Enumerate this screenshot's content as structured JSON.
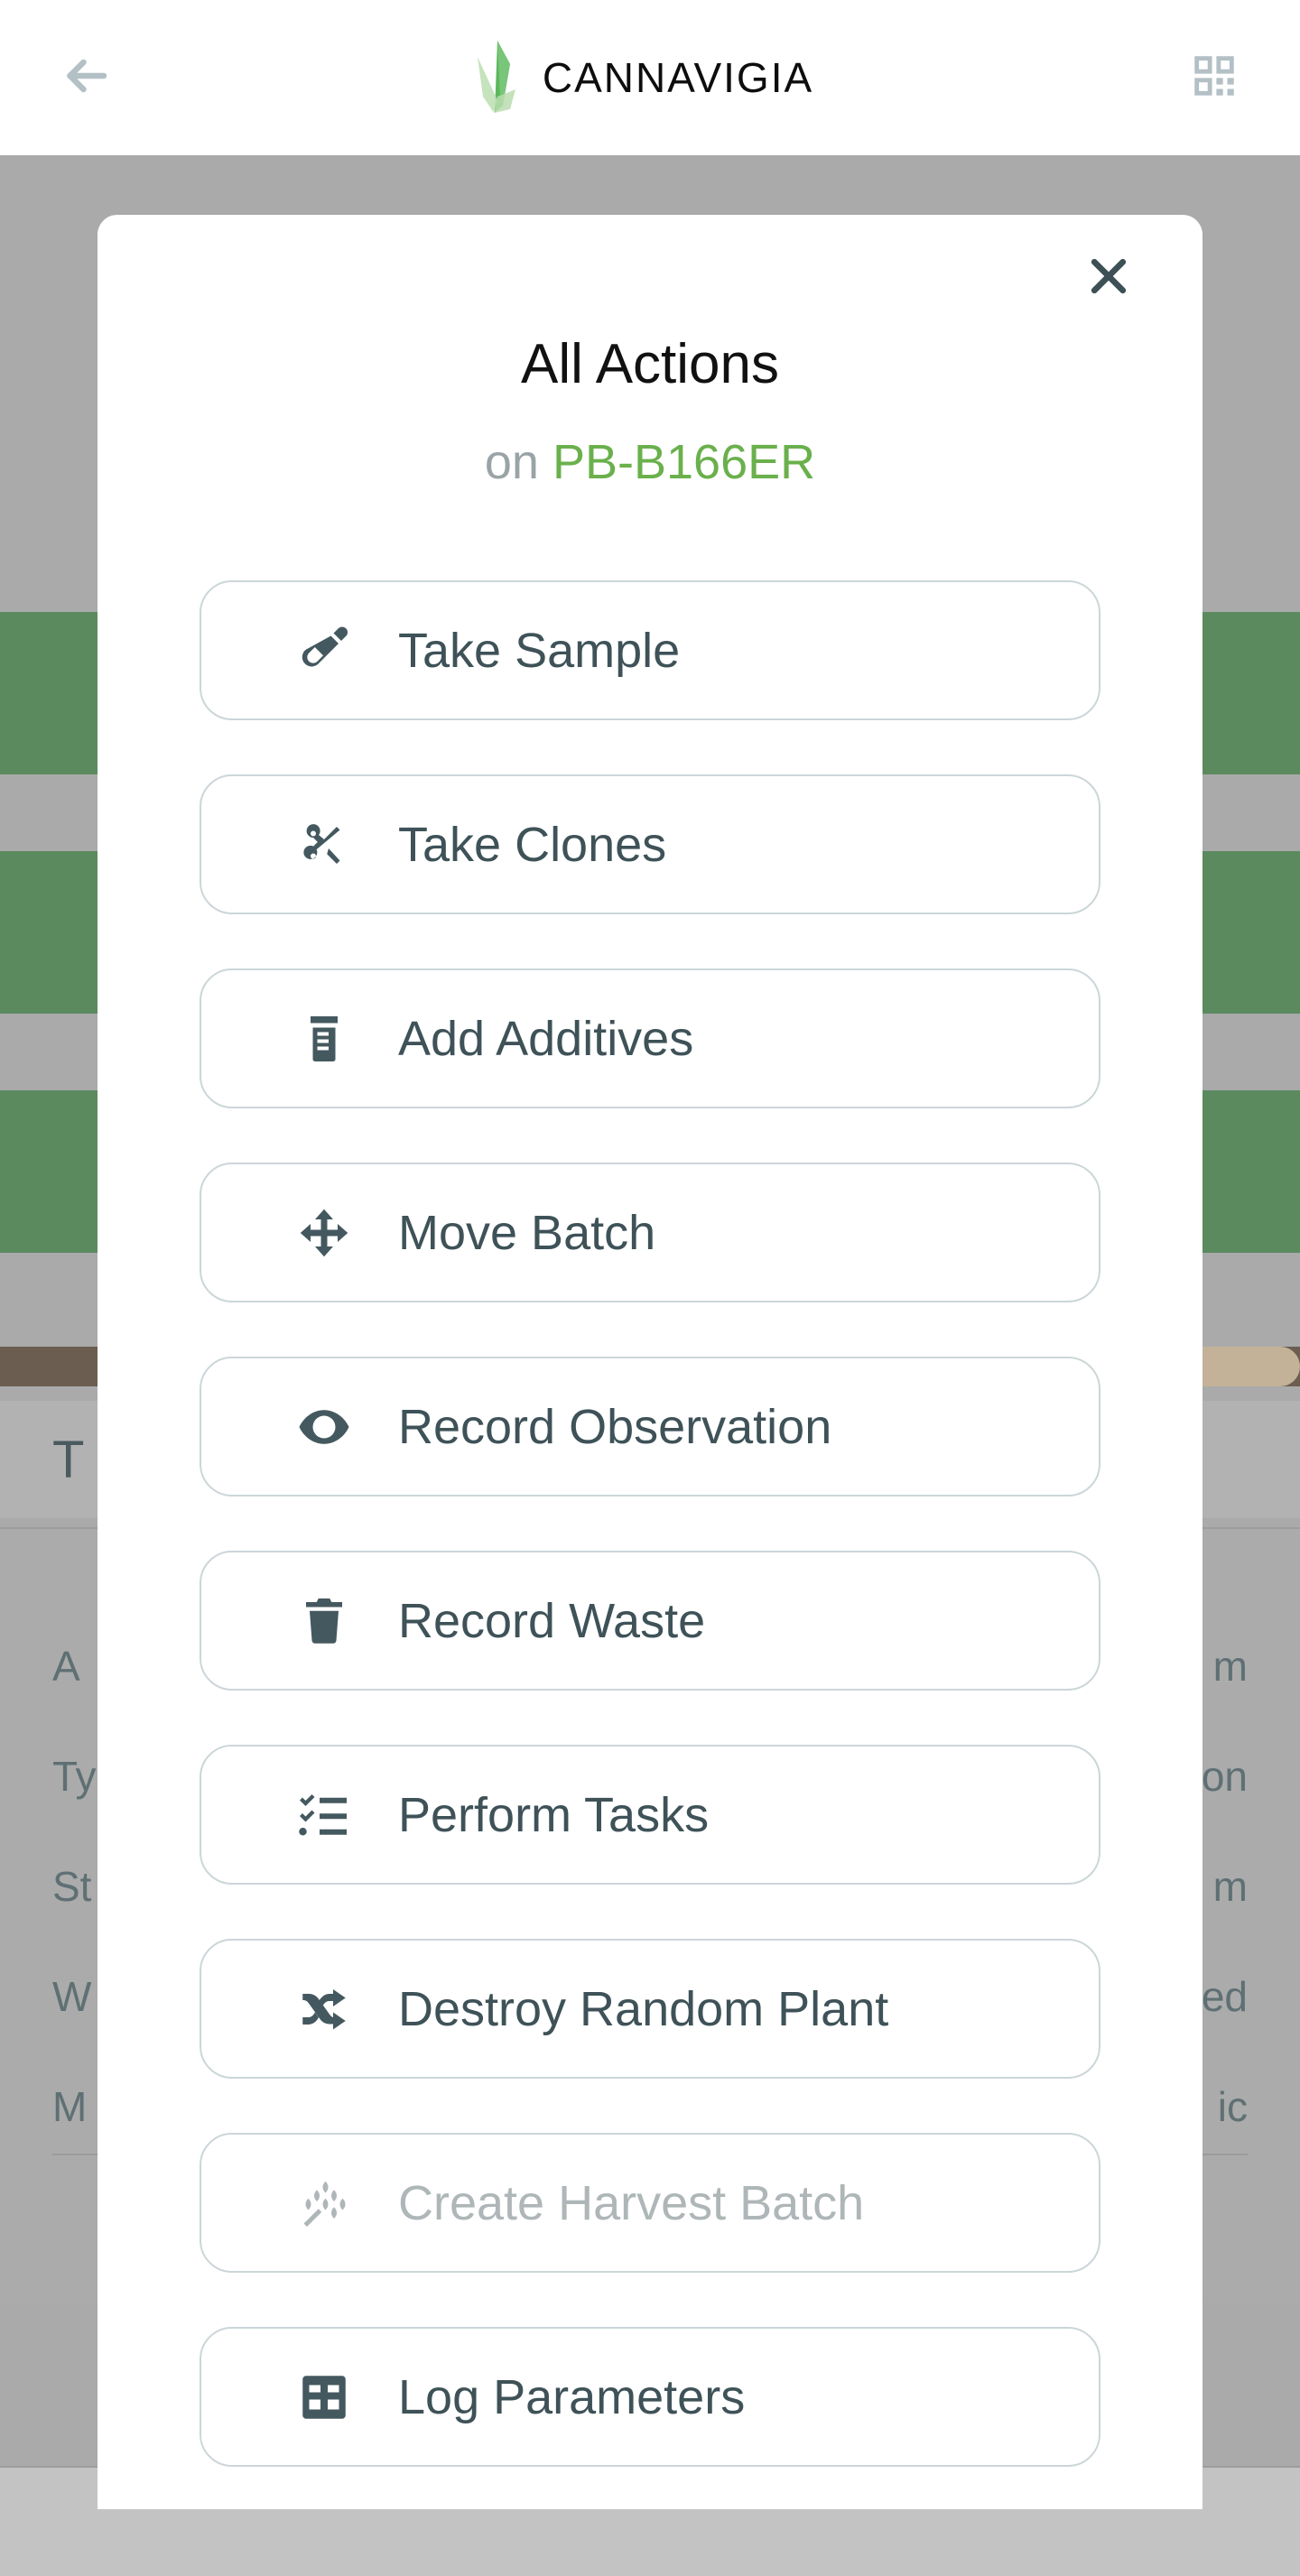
{
  "header": {
    "back_icon": "arrow-left-icon",
    "logo_text": "CANNAVIGIA",
    "logo_mark_icon": "cannavigia-leaf-icon",
    "scan_icon": "qr-code-scan-icon"
  },
  "modal": {
    "close_icon": "close-icon",
    "title": "All Actions",
    "subject_prefix": "on",
    "subject_code": "PB-B166ER",
    "accent_color": "#6ab04c",
    "subject_prefix_color": "#9aa3a6",
    "actions": [
      {
        "label": "Take Sample",
        "icon": "test-tube-icon",
        "disabled": false
      },
      {
        "label": "Take Clones",
        "icon": "scissors-icon",
        "disabled": false
      },
      {
        "label": "Add Additives",
        "icon": "pill-bottle-icon",
        "disabled": false
      },
      {
        "label": "Move Batch",
        "icon": "move-arrows-icon",
        "disabled": false
      },
      {
        "label": "Record Observation",
        "icon": "eye-icon",
        "disabled": false
      },
      {
        "label": "Record Waste",
        "icon": "trash-icon",
        "disabled": false
      },
      {
        "label": "Perform Tasks",
        "icon": "checklist-icon",
        "disabled": false
      },
      {
        "label": "Destroy Random Plant",
        "icon": "shuffle-icon",
        "disabled": false
      },
      {
        "label": "Create Harvest Batch",
        "icon": "wheat-icon",
        "disabled": true
      },
      {
        "label": "Log Parameters",
        "icon": "grid-table-icon",
        "disabled": false
      }
    ]
  },
  "background": {
    "tile_color": "#5b8a5f",
    "overlay_color": "#aaaaaa",
    "tiles": [
      {
        "icon": "scissors-icon"
      },
      {
        "icon": "trash-icon"
      },
      {
        "icon": "grid-table-icon"
      },
      {
        "icon": "expand-arrows-icon"
      },
      {
        "icon": "flask-icon"
      },
      {
        "icon": "more-dots-icon"
      }
    ],
    "title_fragment": "T",
    "rows": [
      {
        "left": "A",
        "right": "m"
      },
      {
        "left": "Ty",
        "right": "on"
      },
      {
        "left": "St",
        "right": "m"
      },
      {
        "left": "W",
        "right": "ed"
      },
      {
        "left": "M",
        "right": "ic"
      }
    ]
  }
}
